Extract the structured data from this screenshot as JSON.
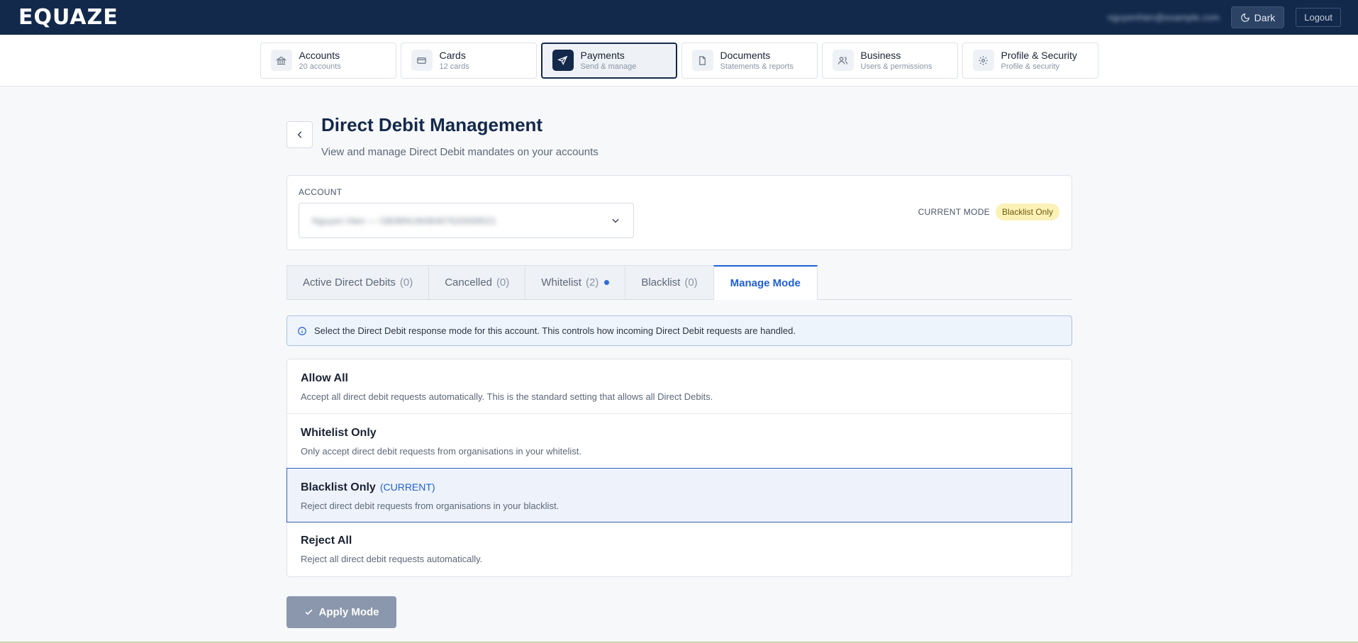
{
  "topbar": {
    "logo": "EQUAZE",
    "user_email": "nguyenhien@example.com",
    "dark_label": "Dark",
    "logout_label": "Logout"
  },
  "nav": [
    {
      "title": "Accounts",
      "sub": "20 accounts",
      "icon": "bank-icon"
    },
    {
      "title": "Cards",
      "sub": "12 cards",
      "icon": "card-icon"
    },
    {
      "title": "Payments",
      "sub": "Send & manage",
      "icon": "send-icon",
      "active": true
    },
    {
      "title": "Documents",
      "sub": "Statements & reports",
      "icon": "document-icon"
    },
    {
      "title": "Business",
      "sub": "Users & permissions",
      "icon": "users-icon"
    },
    {
      "title": "Profile & Security",
      "sub": "Profile & security",
      "icon": "gear-icon"
    }
  ],
  "page": {
    "title": "Direct Debit Management",
    "subtitle": "View and manage Direct Debit mandates on your accounts"
  },
  "account": {
    "label": "ACCOUNT",
    "selected": "Nguyen Hien — GB38NUM48467620009521",
    "current_mode_label": "CURRENT MODE",
    "current_mode": "Blacklist Only"
  },
  "tabs": [
    {
      "label": "Active Direct Debits",
      "count": "(0)"
    },
    {
      "label": "Cancelled",
      "count": "(0)"
    },
    {
      "label": "Whitelist",
      "count": "(2)",
      "dot": true
    },
    {
      "label": "Blacklist",
      "count": "(0)"
    },
    {
      "label": "Manage Mode",
      "count": "",
      "active": true
    }
  ],
  "info": "Select the Direct Debit response mode for this account. This controls how incoming Direct Debit requests are handled.",
  "options": [
    {
      "title": "Allow All",
      "desc": "Accept all direct debit requests automatically. This is the standard setting that allows all Direct Debits.",
      "current": ""
    },
    {
      "title": "Whitelist Only",
      "desc": "Only accept direct debit requests from organisations in your whitelist.",
      "current": ""
    },
    {
      "title": "Blacklist Only",
      "desc": "Reject direct debit requests from organisations in your blacklist.",
      "current": "(CURRENT)"
    },
    {
      "title": "Reject All",
      "desc": "Reject all direct debit requests automatically.",
      "current": ""
    }
  ],
  "apply_label": "Apply Mode",
  "colors": {
    "navy": "#13294b",
    "accent": "#1f5fd6",
    "badge": "#fcf2b8"
  }
}
